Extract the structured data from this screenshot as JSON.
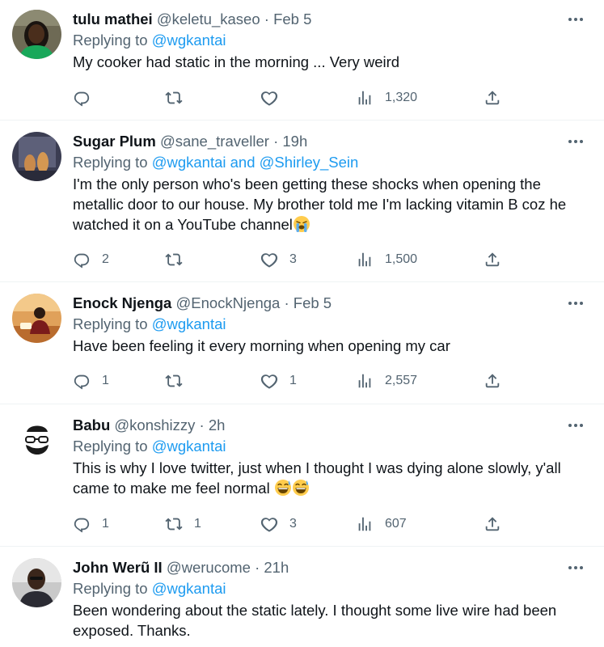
{
  "tweets": [
    {
      "name": "tulu mathei",
      "handle": "@keletu_kaseo",
      "sep": "·",
      "time": "Feb 5",
      "reply_prefix": "Replying to",
      "mentions": [
        "@wgkantai"
      ],
      "mention_joiner": "",
      "text": "My cooker had static in the morning ... Very weird",
      "emoji": [],
      "replies": "",
      "retweets": "",
      "likes": "",
      "views": "1,320"
    },
    {
      "name": "Sugar Plum",
      "handle": "@sane_traveller",
      "sep": "·",
      "time": "19h",
      "reply_prefix": "Replying to",
      "mentions": [
        "@wgkantai",
        "@Shirley_Sein"
      ],
      "mention_joiner": "and",
      "text": "I'm the only person who's been getting these shocks when opening the metallic door to our house. My brother told me I'm lacking vitamin B coz he watched it on a YouTube channel",
      "emoji": [
        "loudly-crying-face"
      ],
      "replies": "2",
      "retweets": "",
      "likes": "3",
      "views": "1,500"
    },
    {
      "name": "Enock Njenga",
      "handle": "@EnockNjenga",
      "sep": "·",
      "time": "Feb 5",
      "reply_prefix": "Replying to",
      "mentions": [
        "@wgkantai"
      ],
      "mention_joiner": "",
      "text": "Have been feeling it every morning when opening my car",
      "emoji": [],
      "replies": "1",
      "retweets": "",
      "likes": "1",
      "views": "2,557"
    },
    {
      "name": "Babu",
      "handle": "@konshizzy",
      "sep": "·",
      "time": "2h",
      "reply_prefix": "Replying to",
      "mentions": [
        "@wgkantai"
      ],
      "mention_joiner": "",
      "text": "This is why I love twitter, just when I thought I was dying alone slowly, y'all came to make me feel normal ",
      "emoji": [
        "grinning-sweat-face",
        "grinning-sweat-face"
      ],
      "replies": "1",
      "retweets": "1",
      "likes": "3",
      "views": "607"
    },
    {
      "name": "John Werũ II",
      "handle": "@werucome",
      "sep": "·",
      "time": "21h",
      "reply_prefix": "Replying to",
      "mentions": [
        "@wgkantai"
      ],
      "mention_joiner": "",
      "text": "Been wondering about the static lately. I thought some live wire had been exposed. Thanks.",
      "emoji": [],
      "replies": "",
      "retweets": "",
      "likes": "",
      "views": ""
    }
  ],
  "icons": [
    "reply-icon",
    "retweet-icon",
    "like-icon",
    "views-icon",
    "share-icon",
    "more-icon"
  ],
  "colors": {
    "link": "#1d9bf0",
    "muted": "#536471",
    "text": "#0f1419",
    "divider": "#eff3f4"
  }
}
